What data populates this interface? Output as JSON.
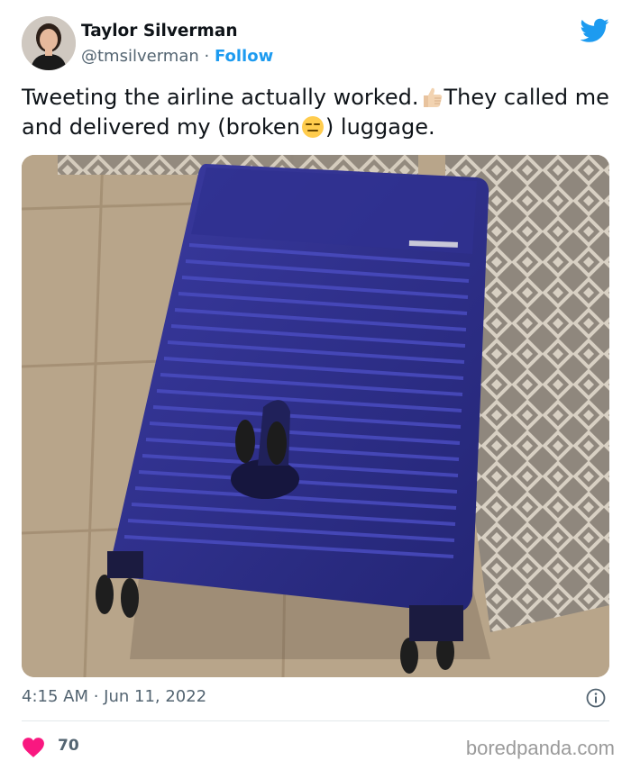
{
  "tweet": {
    "author_name": "Taylor Silverman",
    "handle": "@tmsilverman",
    "separator": " · ",
    "follow_label": "Follow",
    "text_part1": "Tweeting the airline actually worked.",
    "text_part2": "They called me and delivered my (broken",
    "text_part3": ") luggage.",
    "timestamp": "4:15 AM · Jun 11, 2022",
    "like_count": "70",
    "watermark": "boredpanda.com"
  },
  "icons": {
    "platform": "twitter-bird-icon",
    "thumbs_up": "thumbs-up-emoji",
    "expressionless": "expressionless-face-emoji",
    "info": "info-icon",
    "like": "heart-icon"
  },
  "colors": {
    "accent": "#1d9bf0",
    "like": "#f91880",
    "text": "#0f1419",
    "secondary": "#536471"
  }
}
